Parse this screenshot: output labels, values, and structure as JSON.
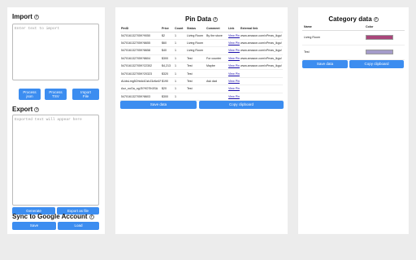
{
  "left": {
    "import_title": "Import",
    "import_placeholder": "Enter text to import",
    "buttons_import": [
      "Process\njson",
      "Process\nTSV",
      "Import\nFile"
    ],
    "export_title": "Export",
    "export_placeholder": "Exported text will appear here",
    "btn_generate": "Generate",
    "btn_export_file": "Export as file",
    "sync_title": "Sync to Google Account",
    "btn_save": "Save",
    "btn_load": "Load"
  },
  "pin": {
    "title": "Pin Data",
    "columns": [
      "PinID",
      "Price",
      "Count",
      "Status",
      "Comment",
      "Link",
      "External link"
    ],
    "rows": [
      [
        "5470161327059?9050",
        "$2",
        "1",
        "Living Room",
        "By the stove",
        "View Pin",
        "www.amazon.com/xPmav_lkgo/"
      ],
      [
        "5470161327059?8655",
        "$60",
        "1",
        "Living Room",
        "",
        "View Pin",
        "www.amazon.com/xPmav_lkgo/"
      ],
      [
        "5470161327059?8658",
        "$40",
        "1",
        "Living Room",
        "",
        "View Pin",
        "www.amazon.com/xPmav_lkgo/"
      ],
      [
        "5470161327059?8604",
        "$300",
        "1",
        "Test",
        "For counter",
        "View Pin",
        "www.amazon.com/xPmav_lkgo/"
      ],
      [
        "5470161327059?22302",
        "$4,213",
        "1",
        "Test",
        "Maybe",
        "View Pin",
        "www.amazon.com/xPmav_lkgo/"
      ],
      [
        "5470161327059?20323",
        "$320",
        "1",
        "Test",
        "",
        "View Pin",
        ""
      ],
      [
        "AUdsLmg5OhbA4CsbJ3z6w1F",
        "$190",
        "1",
        "Test",
        "Ask dad",
        "View Pin",
        ""
      ],
      [
        "Azz_ouGa_ogJ5?9O7Ih3SA",
        "$20",
        "1",
        "Test",
        "",
        "View Pin",
        ""
      ],
      [
        "5470161327059?8603",
        "$300",
        "1",
        "",
        "",
        "View Pin",
        ""
      ]
    ],
    "btn_save": "Save data",
    "btn_copy": "Copy clipboard"
  },
  "category": {
    "title": "Category data",
    "columns": [
      "Name",
      "Color"
    ],
    "rows": [
      {
        "name": "Living Room",
        "color": "#a9467a"
      },
      {
        "name": "Test",
        "color": "#a49cca"
      }
    ],
    "btn_save": "Save data",
    "btn_copy": "Copy clipboard"
  },
  "colors": {
    "button": "#3c8df0",
    "background": "#ececec",
    "link": "#1a0dab"
  }
}
